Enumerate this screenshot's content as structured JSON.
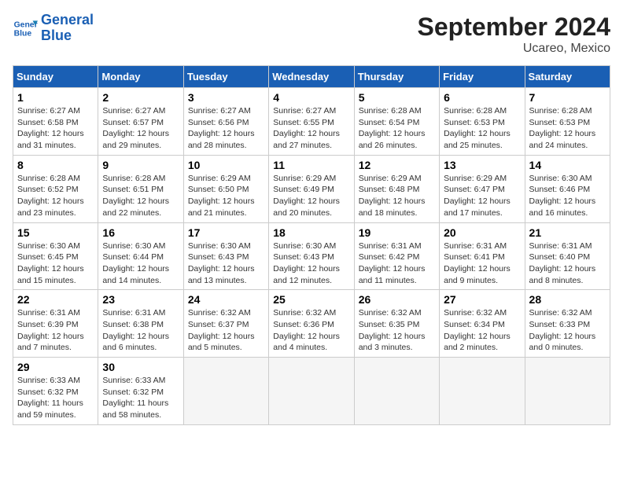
{
  "header": {
    "logo_line1": "General",
    "logo_line2": "Blue",
    "title": "September 2024",
    "subtitle": "Ucareo, Mexico"
  },
  "days_of_week": [
    "Sunday",
    "Monday",
    "Tuesday",
    "Wednesday",
    "Thursday",
    "Friday",
    "Saturday"
  ],
  "weeks": [
    [
      {
        "day": "1",
        "info": "Sunrise: 6:27 AM\nSunset: 6:58 PM\nDaylight: 12 hours and 31 minutes."
      },
      {
        "day": "2",
        "info": "Sunrise: 6:27 AM\nSunset: 6:57 PM\nDaylight: 12 hours and 29 minutes."
      },
      {
        "day": "3",
        "info": "Sunrise: 6:27 AM\nSunset: 6:56 PM\nDaylight: 12 hours and 28 minutes."
      },
      {
        "day": "4",
        "info": "Sunrise: 6:27 AM\nSunset: 6:55 PM\nDaylight: 12 hours and 27 minutes."
      },
      {
        "day": "5",
        "info": "Sunrise: 6:28 AM\nSunset: 6:54 PM\nDaylight: 12 hours and 26 minutes."
      },
      {
        "day": "6",
        "info": "Sunrise: 6:28 AM\nSunset: 6:53 PM\nDaylight: 12 hours and 25 minutes."
      },
      {
        "day": "7",
        "info": "Sunrise: 6:28 AM\nSunset: 6:53 PM\nDaylight: 12 hours and 24 minutes."
      }
    ],
    [
      {
        "day": "8",
        "info": "Sunrise: 6:28 AM\nSunset: 6:52 PM\nDaylight: 12 hours and 23 minutes."
      },
      {
        "day": "9",
        "info": "Sunrise: 6:28 AM\nSunset: 6:51 PM\nDaylight: 12 hours and 22 minutes."
      },
      {
        "day": "10",
        "info": "Sunrise: 6:29 AM\nSunset: 6:50 PM\nDaylight: 12 hours and 21 minutes."
      },
      {
        "day": "11",
        "info": "Sunrise: 6:29 AM\nSunset: 6:49 PM\nDaylight: 12 hours and 20 minutes."
      },
      {
        "day": "12",
        "info": "Sunrise: 6:29 AM\nSunset: 6:48 PM\nDaylight: 12 hours and 18 minutes."
      },
      {
        "day": "13",
        "info": "Sunrise: 6:29 AM\nSunset: 6:47 PM\nDaylight: 12 hours and 17 minutes."
      },
      {
        "day": "14",
        "info": "Sunrise: 6:30 AM\nSunset: 6:46 PM\nDaylight: 12 hours and 16 minutes."
      }
    ],
    [
      {
        "day": "15",
        "info": "Sunrise: 6:30 AM\nSunset: 6:45 PM\nDaylight: 12 hours and 15 minutes."
      },
      {
        "day": "16",
        "info": "Sunrise: 6:30 AM\nSunset: 6:44 PM\nDaylight: 12 hours and 14 minutes."
      },
      {
        "day": "17",
        "info": "Sunrise: 6:30 AM\nSunset: 6:43 PM\nDaylight: 12 hours and 13 minutes."
      },
      {
        "day": "18",
        "info": "Sunrise: 6:30 AM\nSunset: 6:43 PM\nDaylight: 12 hours and 12 minutes."
      },
      {
        "day": "19",
        "info": "Sunrise: 6:31 AM\nSunset: 6:42 PM\nDaylight: 12 hours and 11 minutes."
      },
      {
        "day": "20",
        "info": "Sunrise: 6:31 AM\nSunset: 6:41 PM\nDaylight: 12 hours and 9 minutes."
      },
      {
        "day": "21",
        "info": "Sunrise: 6:31 AM\nSunset: 6:40 PM\nDaylight: 12 hours and 8 minutes."
      }
    ],
    [
      {
        "day": "22",
        "info": "Sunrise: 6:31 AM\nSunset: 6:39 PM\nDaylight: 12 hours and 7 minutes."
      },
      {
        "day": "23",
        "info": "Sunrise: 6:31 AM\nSunset: 6:38 PM\nDaylight: 12 hours and 6 minutes."
      },
      {
        "day": "24",
        "info": "Sunrise: 6:32 AM\nSunset: 6:37 PM\nDaylight: 12 hours and 5 minutes."
      },
      {
        "day": "25",
        "info": "Sunrise: 6:32 AM\nSunset: 6:36 PM\nDaylight: 12 hours and 4 minutes."
      },
      {
        "day": "26",
        "info": "Sunrise: 6:32 AM\nSunset: 6:35 PM\nDaylight: 12 hours and 3 minutes."
      },
      {
        "day": "27",
        "info": "Sunrise: 6:32 AM\nSunset: 6:34 PM\nDaylight: 12 hours and 2 minutes."
      },
      {
        "day": "28",
        "info": "Sunrise: 6:32 AM\nSunset: 6:33 PM\nDaylight: 12 hours and 0 minutes."
      }
    ],
    [
      {
        "day": "29",
        "info": "Sunrise: 6:33 AM\nSunset: 6:32 PM\nDaylight: 11 hours and 59 minutes."
      },
      {
        "day": "30",
        "info": "Sunrise: 6:33 AM\nSunset: 6:32 PM\nDaylight: 11 hours and 58 minutes."
      },
      {
        "day": "",
        "info": ""
      },
      {
        "day": "",
        "info": ""
      },
      {
        "day": "",
        "info": ""
      },
      {
        "day": "",
        "info": ""
      },
      {
        "day": "",
        "info": ""
      }
    ]
  ]
}
